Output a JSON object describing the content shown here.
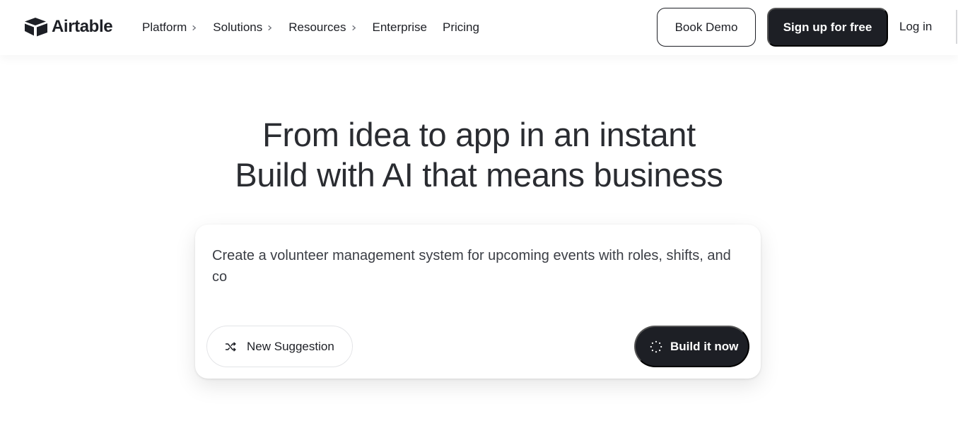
{
  "brand": {
    "name": "Airtable"
  },
  "nav": {
    "items": [
      {
        "label": "Platform",
        "has_chevron": true
      },
      {
        "label": "Solutions",
        "has_chevron": true
      },
      {
        "label": "Resources",
        "has_chevron": true
      },
      {
        "label": "Enterprise",
        "has_chevron": false
      },
      {
        "label": "Pricing",
        "has_chevron": false
      }
    ],
    "book_demo": "Book Demo",
    "sign_up": "Sign up for free",
    "log_in": "Log in"
  },
  "hero": {
    "line1": "From idea to app in an instant",
    "line2": "Build with AI that means business"
  },
  "prompt_card": {
    "prompt_text": "Create a volunteer management system for upcoming events with roles, shifts, and co",
    "new_suggestion": "New Suggestion",
    "build_now": "Build it now"
  },
  "icons": {
    "logo": "airtable-logo-icon",
    "chevron": "chevron-right-icon",
    "shuffle": "shuffle-icon",
    "spinner": "loading-spinner-icon"
  },
  "colors": {
    "dark": "#1d1f25",
    "text": "#2a2c31",
    "border": "#e3e4e7"
  }
}
